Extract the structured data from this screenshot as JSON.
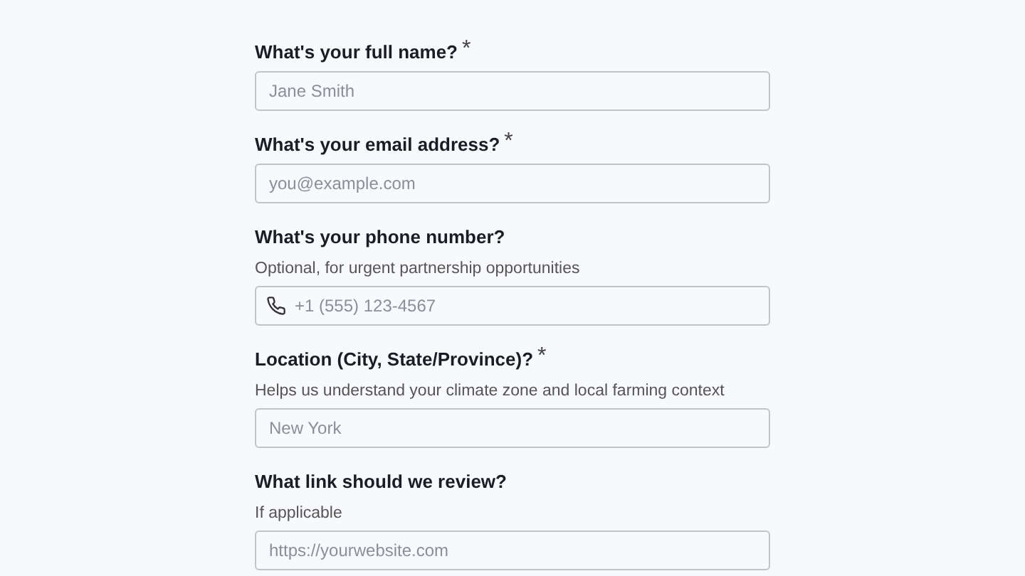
{
  "fields": [
    {
      "kind": "text",
      "label": "What's your full name?",
      "required_mark": "*",
      "placeholder": "Jane Smith"
    },
    {
      "kind": "text",
      "label": "What's your email address?",
      "required_mark": "*",
      "placeholder": "you@example.com"
    },
    {
      "kind": "phone",
      "label": "What's your phone number?",
      "hint": "Optional, for urgent partnership opportunities",
      "placeholder": "+1 (555) 123-4567"
    },
    {
      "kind": "text",
      "label": "Location (City, State/Province)?",
      "required_mark": "*",
      "hint": "Helps us understand your climate zone and local farming context",
      "placeholder": "New York"
    },
    {
      "kind": "text",
      "label": "What link should we review?",
      "hint": "If applicable",
      "placeholder": "https://yourwebsite.com"
    }
  ]
}
